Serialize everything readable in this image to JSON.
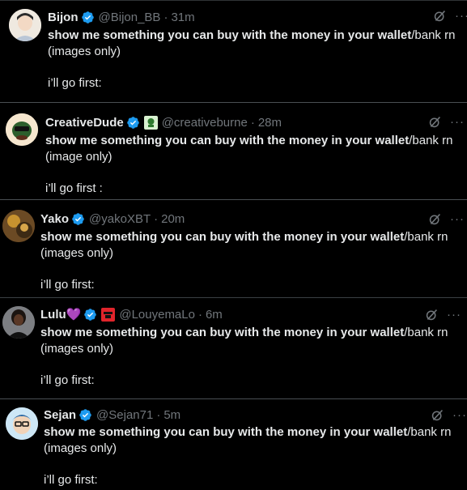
{
  "colors": {
    "background": "#000000",
    "text": "#e7e9ea",
    "secondary": "#71767b",
    "verified": "#1d9bf0",
    "divider": "#2f3336"
  },
  "tweets": [
    {
      "name": "Bijon",
      "handle": "@Bijon_BB",
      "time": "31m",
      "bold_text": "show me something you can buy with the money in your wallet",
      "rest_text": "/bank rn",
      "line2": "(images only)",
      "line3": "i’ll go first:"
    },
    {
      "name": "CreativeDude",
      "handle": "@creativeburne",
      "time": "28m",
      "bold_text": "show me something you can buy with the money in your wallet",
      "rest_text": "/bank rn",
      "line2": "(image only)",
      "line3": "i’ll go first :"
    },
    {
      "name": "Yako",
      "handle": "@yakoXBT",
      "time": "20m",
      "bold_text": "show me something you can buy with the money in your wallet",
      "rest_text": "/bank rn",
      "line2": "(images only)",
      "line3": "i’ll go first:"
    },
    {
      "name": "Lulu💜",
      "handle": "@LouyemaLo",
      "time": "6m",
      "bold_text": "show me something you can buy with the money in your wallet",
      "rest_text": "/bank rn",
      "line2": "(images only)",
      "line3": "i’ll go first:"
    },
    {
      "name": "Sejan",
      "handle": "@Sejan71",
      "time": "5m",
      "bold_text": "show me something you can buy with the money in your wallet",
      "rest_text": "/bank rn",
      "line2": "(images only)",
      "line3": "i’ll go first:"
    }
  ],
  "icons": {
    "verified": "verified-badge-icon",
    "grok": "grok-icon",
    "more": "more-options-icon"
  },
  "separator": "·"
}
